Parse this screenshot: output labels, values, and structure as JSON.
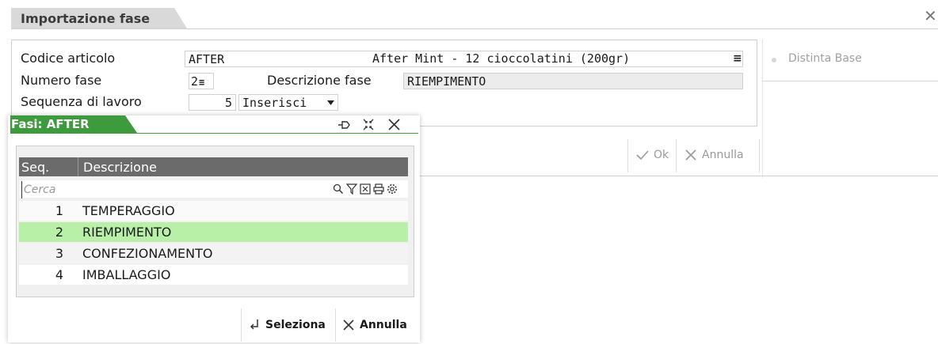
{
  "window": {
    "title": "Importazione fase",
    "close_glyph": "✕"
  },
  "form": {
    "codice_articolo": {
      "label": "Codice articolo",
      "value": "AFTER",
      "description": "After Mint - 12 cioccolatini (200gr)",
      "menu_glyph": "≡"
    },
    "numero_fase": {
      "label": "Numero fase",
      "value": "2",
      "menu_glyph": "≡"
    },
    "descrizione_fase": {
      "label": "Descrizione fase",
      "value": "RIEMPIMENTO"
    },
    "sequenza": {
      "label": "Sequenza di lavoro",
      "value": "5",
      "mode": "Inserisci"
    }
  },
  "side": {
    "distinta_base": "Distinta Base"
  },
  "actions": {
    "ok": "Ok",
    "annulla": "Annulla"
  },
  "popup": {
    "title": "Fasi: AFTER",
    "columns": {
      "seq": "Seq.",
      "descrizione": "Descrizione"
    },
    "search_placeholder": "Cerca",
    "rows": [
      {
        "seq": "1",
        "descrizione": "TEMPERAGGIO"
      },
      {
        "seq": "2",
        "descrizione": "RIEMPIMENTO"
      },
      {
        "seq": "3",
        "descrizione": "CONFEZIONAMENTO"
      },
      {
        "seq": "4",
        "descrizione": "IMBALLAGGIO"
      }
    ],
    "selected_index": 1,
    "buttons": {
      "seleziona": "Seleziona",
      "annulla": "Annulla"
    }
  },
  "colors": {
    "accent_green": "#3d9b3d",
    "selected_row": "#b8f0a8",
    "header_grey": "#6b6b6b"
  }
}
